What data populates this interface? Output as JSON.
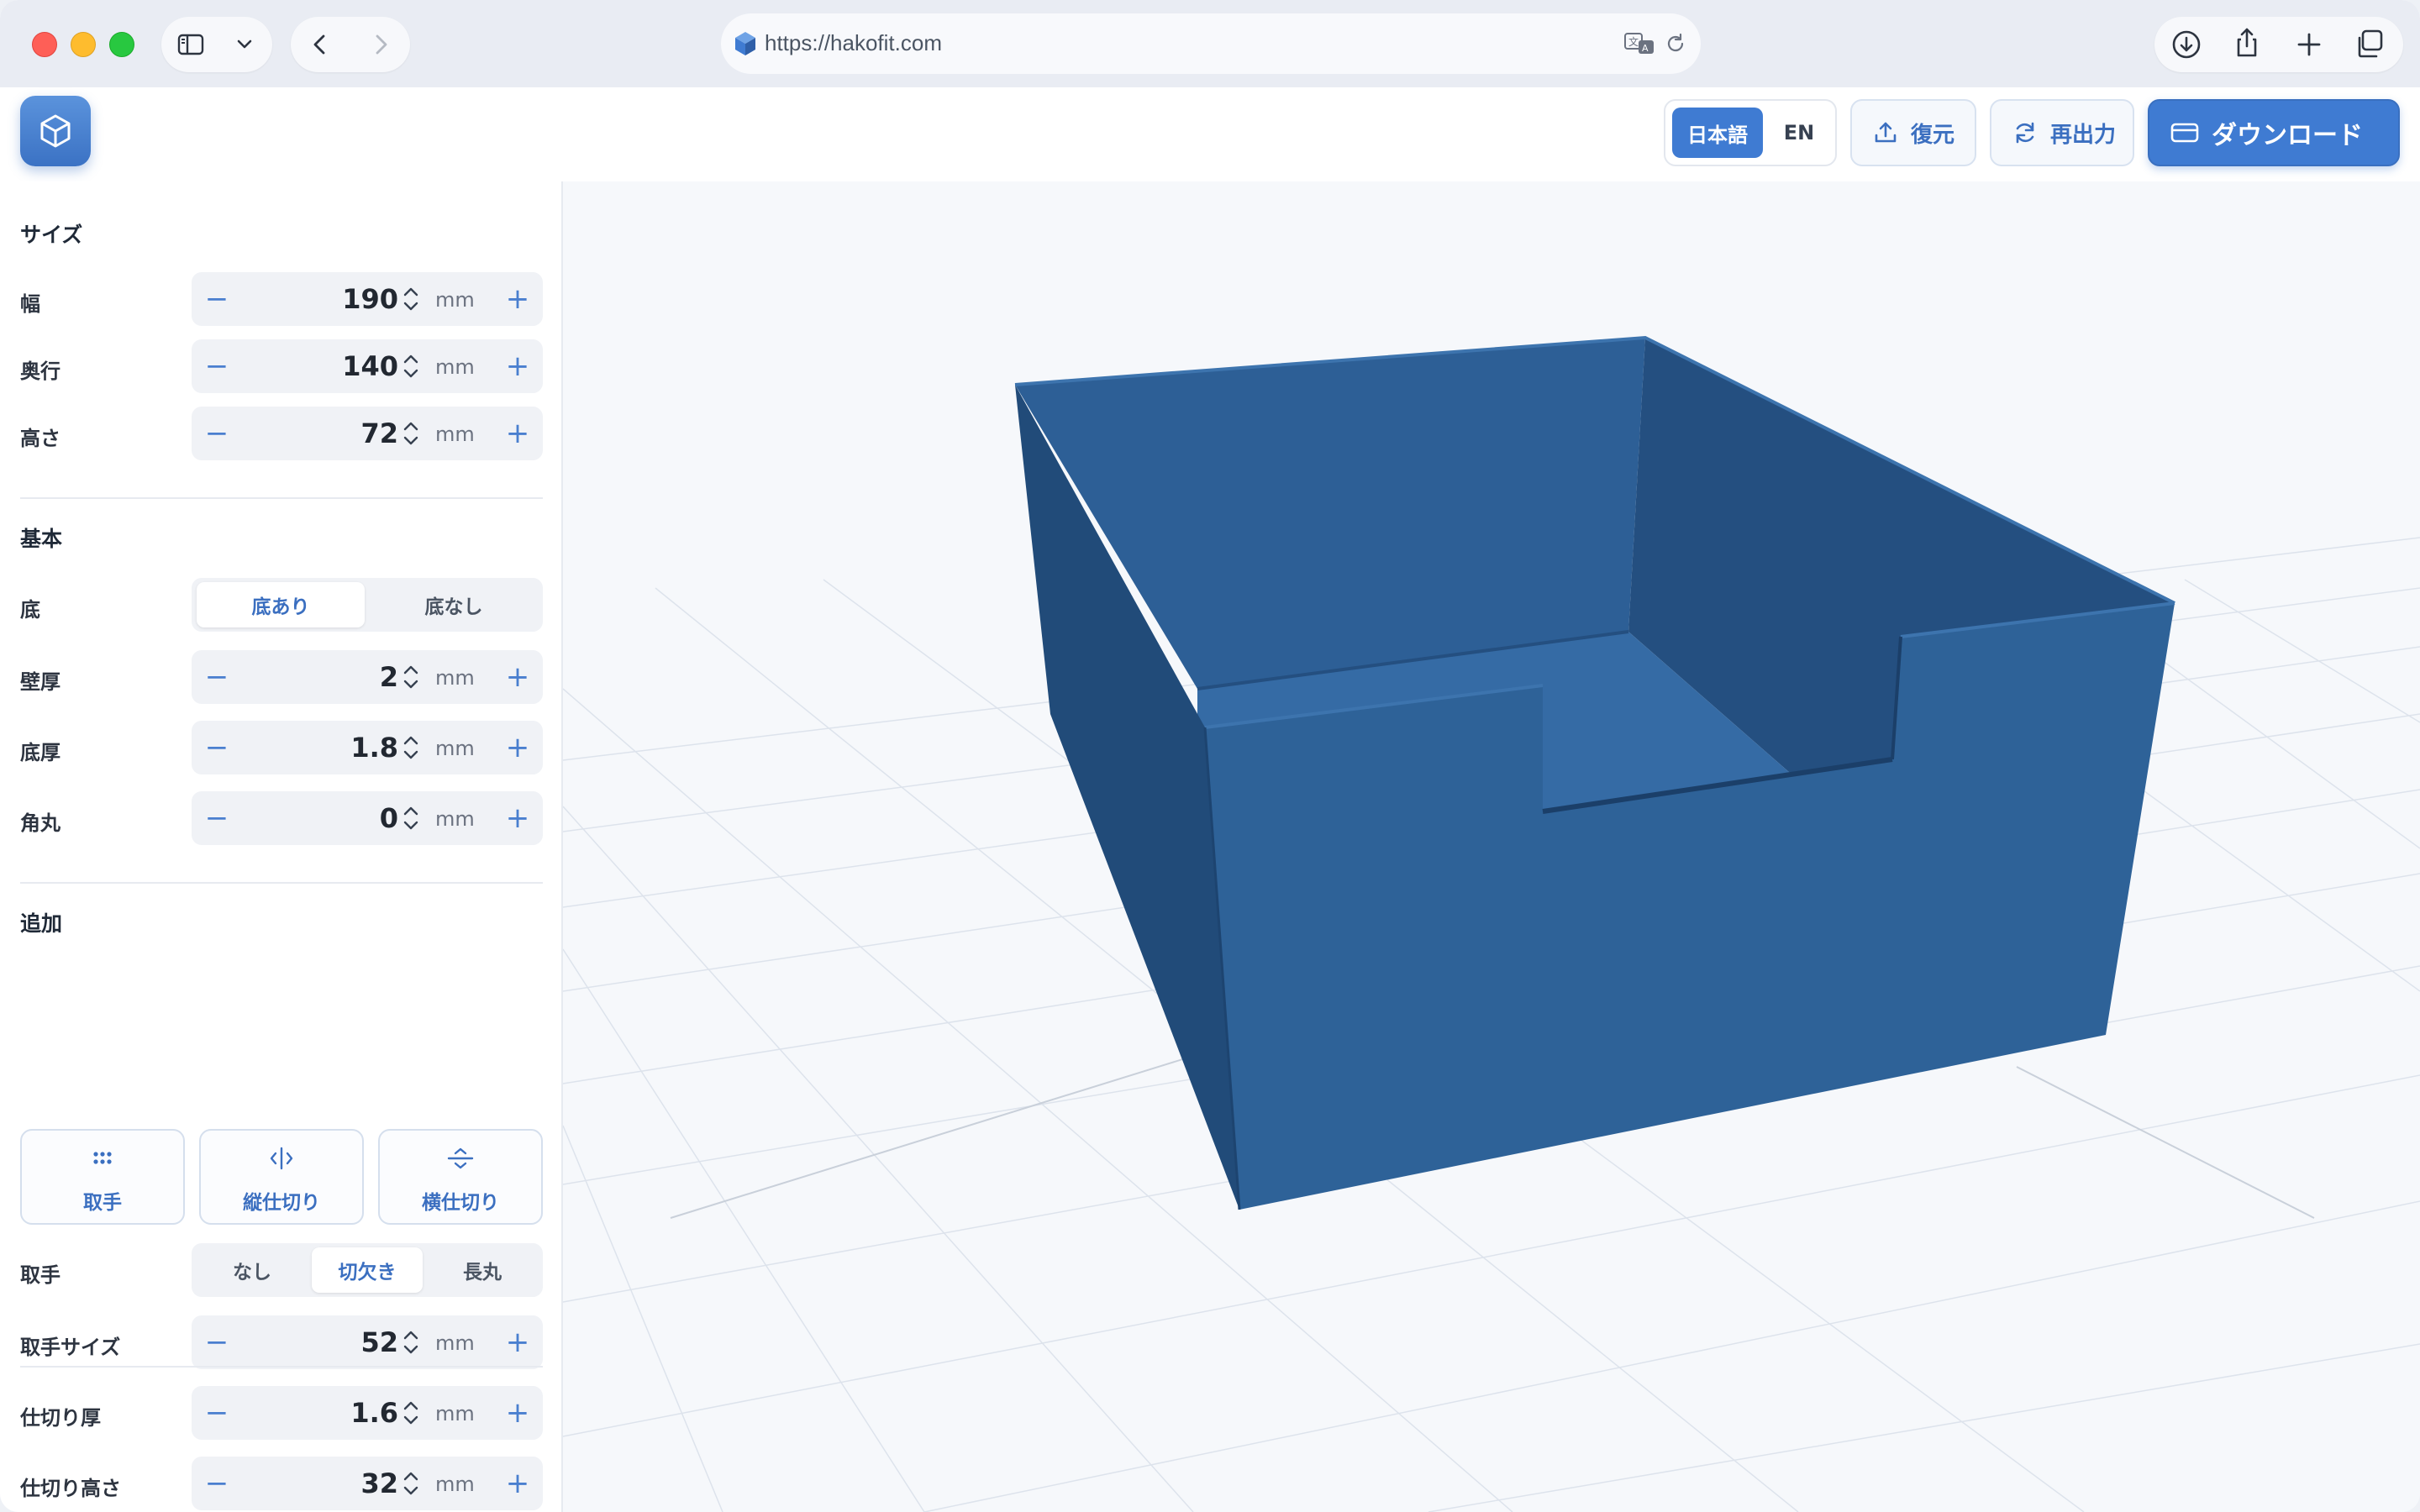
{
  "browser": {
    "url": "https://hakofit.com"
  },
  "header": {
    "lang_ja": "日本語",
    "lang_en": "EN",
    "restore_label": "復元",
    "rerender_label": "再出力",
    "download_label": "ダウンロード",
    "accent_color": "#3f7bd2"
  },
  "sidebar": {
    "size_section": "サイズ",
    "width": {
      "label": "幅",
      "value": "190",
      "unit": "mm"
    },
    "depth": {
      "label": "奥行",
      "value": "140",
      "unit": "mm"
    },
    "height": {
      "label": "高さ",
      "value": "72",
      "unit": "mm"
    },
    "basic_section": "基本",
    "bottom": {
      "label": "底",
      "options": [
        "底あり",
        "底なし"
      ],
      "selected": "底あり"
    },
    "wall": {
      "label": "壁厚",
      "value": "2",
      "unit": "mm"
    },
    "floor": {
      "label": "底厚",
      "value": "1.8",
      "unit": "mm"
    },
    "radius": {
      "label": "角丸",
      "value": "0",
      "unit": "mm"
    },
    "add_section": "追加",
    "add_cards": [
      "取手",
      "縦仕切り",
      "横仕切り"
    ],
    "handle": {
      "label": "取手",
      "options": [
        "なし",
        "切欠き",
        "長丸"
      ],
      "selected": "切欠き"
    },
    "handle_size": {
      "label": "取手サイズ",
      "value": "52",
      "unit": "mm"
    },
    "divider_thickness": {
      "label": "仕切り厚",
      "value": "1.6",
      "unit": "mm"
    },
    "divider_height": {
      "label": "仕切り高さ",
      "value": "32",
      "unit": "mm"
    }
  },
  "viewport": {
    "model_color": "#2e6298"
  }
}
